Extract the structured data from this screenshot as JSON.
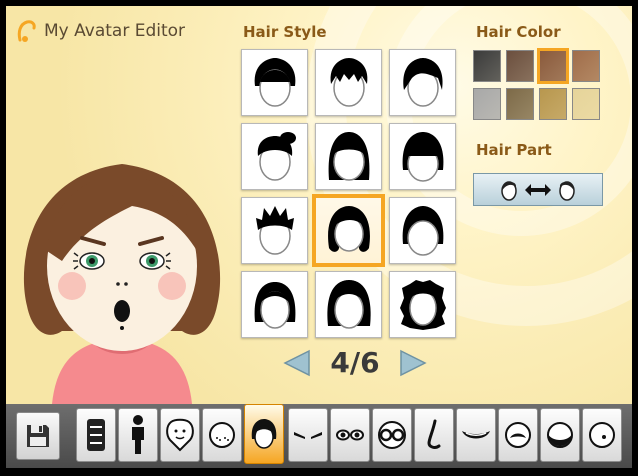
{
  "app": {
    "title": "My Avatar Editor"
  },
  "hair_style": {
    "label": "Hair Style",
    "tiles": [
      {
        "icon": "hair-style-1-icon"
      },
      {
        "icon": "hair-style-2-icon"
      },
      {
        "icon": "hair-style-3-icon"
      },
      {
        "icon": "hair-style-4-icon"
      },
      {
        "icon": "hair-style-5-icon"
      },
      {
        "icon": "hair-style-6-icon"
      },
      {
        "icon": "hair-style-7-icon"
      },
      {
        "icon": "hair-style-8-icon",
        "selected": true
      },
      {
        "icon": "hair-style-9-icon"
      },
      {
        "icon": "hair-style-10-icon"
      },
      {
        "icon": "hair-style-11-icon"
      },
      {
        "icon": "hair-style-12-icon"
      }
    ],
    "page": "4/6"
  },
  "hair_color": {
    "label": "Hair Color",
    "swatches": [
      "#3b3b3b",
      "#6b4f3e",
      "#8a5a3c",
      "#a06d4a",
      "#a8a8a8",
      "#7d6a48",
      "#b8974e",
      "#e6d49a"
    ],
    "selected_index": 2
  },
  "hair_part": {
    "label": "Hair Part"
  },
  "colors": {
    "accent": "#f5a623",
    "label": "#8a5a18",
    "skin": "#fbf0e0",
    "hair": "#7a4a2a",
    "shirt": "#f58a8e"
  },
  "toolbar": {
    "tools": [
      {
        "name": "tool-body-type",
        "icon": "body-type-icon"
      },
      {
        "name": "tool-height",
        "icon": "height-icon"
      },
      {
        "name": "tool-face-shape",
        "icon": "face-shape-icon"
      },
      {
        "name": "tool-face-features",
        "icon": "face-features-icon"
      },
      {
        "name": "tool-hair",
        "icon": "hair-icon",
        "selected": true
      },
      {
        "name": "tool-eyebrows",
        "icon": "eyebrows-icon"
      },
      {
        "name": "tool-eyes",
        "icon": "eyes-icon"
      },
      {
        "name": "tool-glasses",
        "icon": "glasses-icon"
      },
      {
        "name": "tool-nose",
        "icon": "nose-icon"
      },
      {
        "name": "tool-mouth",
        "icon": "mouth-icon"
      },
      {
        "name": "tool-mustache",
        "icon": "mustache-icon"
      },
      {
        "name": "tool-beard",
        "icon": "beard-icon"
      },
      {
        "name": "tool-mole",
        "icon": "mole-icon"
      }
    ]
  }
}
